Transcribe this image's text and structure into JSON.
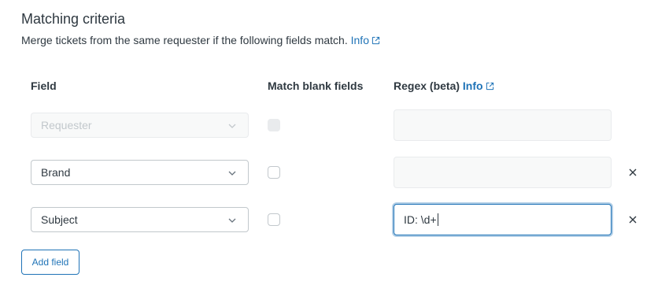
{
  "section": {
    "title": "Matching criteria",
    "description": "Merge tickets from the same requester if the following fields match.",
    "info_link": "Info"
  },
  "columns": {
    "field": "Field",
    "match_blank": "Match blank fields",
    "regex": "Regex (beta)",
    "regex_info": "Info"
  },
  "rows": [
    {
      "field": "Requester",
      "disabled": true,
      "match_blank": false,
      "regex": ""
    },
    {
      "field": "Brand",
      "disabled": false,
      "match_blank": false,
      "regex": ""
    },
    {
      "field": "Subject",
      "disabled": false,
      "match_blank": false,
      "regex": "ID: \\d+"
    }
  ],
  "add_field_label": "Add field",
  "colors": {
    "accent": "#1f73b7",
    "text": "#2f3941",
    "border": "#c2c8cc",
    "disabled_bg": "#f8f9f9"
  },
  "icons": {
    "external_link": "external-link-icon",
    "dropdown": "chevron-down-icon",
    "remove": "close-icon"
  }
}
